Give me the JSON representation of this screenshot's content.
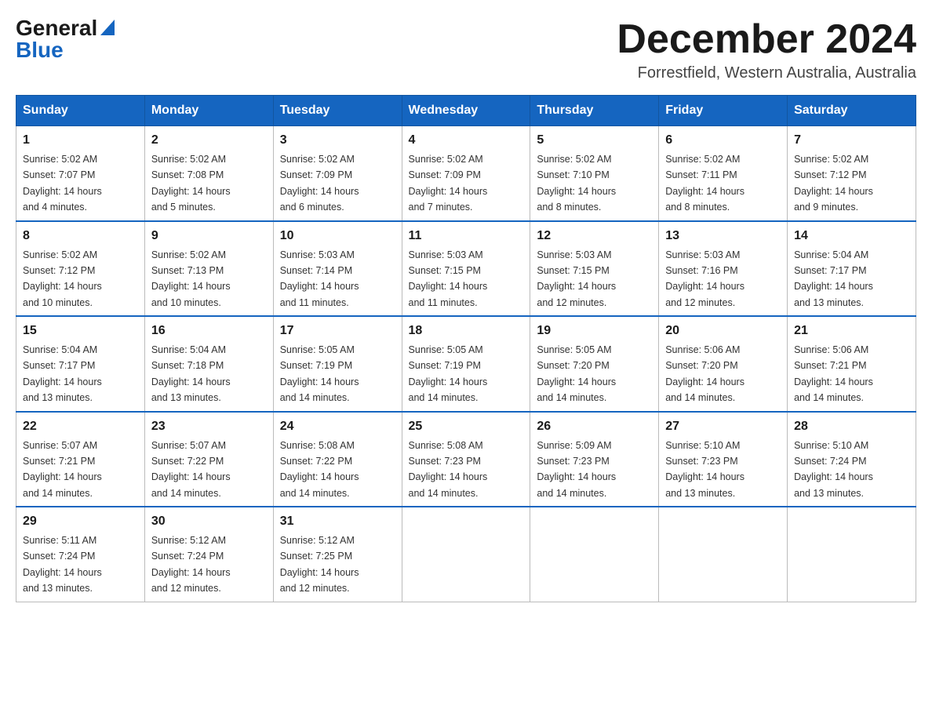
{
  "header": {
    "logo_general": "General",
    "logo_blue": "Blue",
    "month_title": "December 2024",
    "location": "Forrestfield, Western Australia, Australia"
  },
  "columns": [
    "Sunday",
    "Monday",
    "Tuesday",
    "Wednesday",
    "Thursday",
    "Friday",
    "Saturday"
  ],
  "weeks": [
    [
      {
        "day": "1",
        "sunrise": "5:02 AM",
        "sunset": "7:07 PM",
        "daylight": "14 hours and 4 minutes."
      },
      {
        "day": "2",
        "sunrise": "5:02 AM",
        "sunset": "7:08 PM",
        "daylight": "14 hours and 5 minutes."
      },
      {
        "day": "3",
        "sunrise": "5:02 AM",
        "sunset": "7:09 PM",
        "daylight": "14 hours and 6 minutes."
      },
      {
        "day": "4",
        "sunrise": "5:02 AM",
        "sunset": "7:09 PM",
        "daylight": "14 hours and 7 minutes."
      },
      {
        "day": "5",
        "sunrise": "5:02 AM",
        "sunset": "7:10 PM",
        "daylight": "14 hours and 8 minutes."
      },
      {
        "day": "6",
        "sunrise": "5:02 AM",
        "sunset": "7:11 PM",
        "daylight": "14 hours and 8 minutes."
      },
      {
        "day": "7",
        "sunrise": "5:02 AM",
        "sunset": "7:12 PM",
        "daylight": "14 hours and 9 minutes."
      }
    ],
    [
      {
        "day": "8",
        "sunrise": "5:02 AM",
        "sunset": "7:12 PM",
        "daylight": "14 hours and 10 minutes."
      },
      {
        "day": "9",
        "sunrise": "5:02 AM",
        "sunset": "7:13 PM",
        "daylight": "14 hours and 10 minutes."
      },
      {
        "day": "10",
        "sunrise": "5:03 AM",
        "sunset": "7:14 PM",
        "daylight": "14 hours and 11 minutes."
      },
      {
        "day": "11",
        "sunrise": "5:03 AM",
        "sunset": "7:15 PM",
        "daylight": "14 hours and 11 minutes."
      },
      {
        "day": "12",
        "sunrise": "5:03 AM",
        "sunset": "7:15 PM",
        "daylight": "14 hours and 12 minutes."
      },
      {
        "day": "13",
        "sunrise": "5:03 AM",
        "sunset": "7:16 PM",
        "daylight": "14 hours and 12 minutes."
      },
      {
        "day": "14",
        "sunrise": "5:04 AM",
        "sunset": "7:17 PM",
        "daylight": "14 hours and 13 minutes."
      }
    ],
    [
      {
        "day": "15",
        "sunrise": "5:04 AM",
        "sunset": "7:17 PM",
        "daylight": "14 hours and 13 minutes."
      },
      {
        "day": "16",
        "sunrise": "5:04 AM",
        "sunset": "7:18 PM",
        "daylight": "14 hours and 13 minutes."
      },
      {
        "day": "17",
        "sunrise": "5:05 AM",
        "sunset": "7:19 PM",
        "daylight": "14 hours and 14 minutes."
      },
      {
        "day": "18",
        "sunrise": "5:05 AM",
        "sunset": "7:19 PM",
        "daylight": "14 hours and 14 minutes."
      },
      {
        "day": "19",
        "sunrise": "5:05 AM",
        "sunset": "7:20 PM",
        "daylight": "14 hours and 14 minutes."
      },
      {
        "day": "20",
        "sunrise": "5:06 AM",
        "sunset": "7:20 PM",
        "daylight": "14 hours and 14 minutes."
      },
      {
        "day": "21",
        "sunrise": "5:06 AM",
        "sunset": "7:21 PM",
        "daylight": "14 hours and 14 minutes."
      }
    ],
    [
      {
        "day": "22",
        "sunrise": "5:07 AM",
        "sunset": "7:21 PM",
        "daylight": "14 hours and 14 minutes."
      },
      {
        "day": "23",
        "sunrise": "5:07 AM",
        "sunset": "7:22 PM",
        "daylight": "14 hours and 14 minutes."
      },
      {
        "day": "24",
        "sunrise": "5:08 AM",
        "sunset": "7:22 PM",
        "daylight": "14 hours and 14 minutes."
      },
      {
        "day": "25",
        "sunrise": "5:08 AM",
        "sunset": "7:23 PM",
        "daylight": "14 hours and 14 minutes."
      },
      {
        "day": "26",
        "sunrise": "5:09 AM",
        "sunset": "7:23 PM",
        "daylight": "14 hours and 14 minutes."
      },
      {
        "day": "27",
        "sunrise": "5:10 AM",
        "sunset": "7:23 PM",
        "daylight": "14 hours and 13 minutes."
      },
      {
        "day": "28",
        "sunrise": "5:10 AM",
        "sunset": "7:24 PM",
        "daylight": "14 hours and 13 minutes."
      }
    ],
    [
      {
        "day": "29",
        "sunrise": "5:11 AM",
        "sunset": "7:24 PM",
        "daylight": "14 hours and 13 minutes."
      },
      {
        "day": "30",
        "sunrise": "5:12 AM",
        "sunset": "7:24 PM",
        "daylight": "14 hours and 12 minutes."
      },
      {
        "day": "31",
        "sunrise": "5:12 AM",
        "sunset": "7:25 PM",
        "daylight": "14 hours and 12 minutes."
      },
      null,
      null,
      null,
      null
    ]
  ],
  "labels": {
    "sunrise": "Sunrise:",
    "sunset": "Sunset:",
    "daylight": "Daylight:"
  }
}
